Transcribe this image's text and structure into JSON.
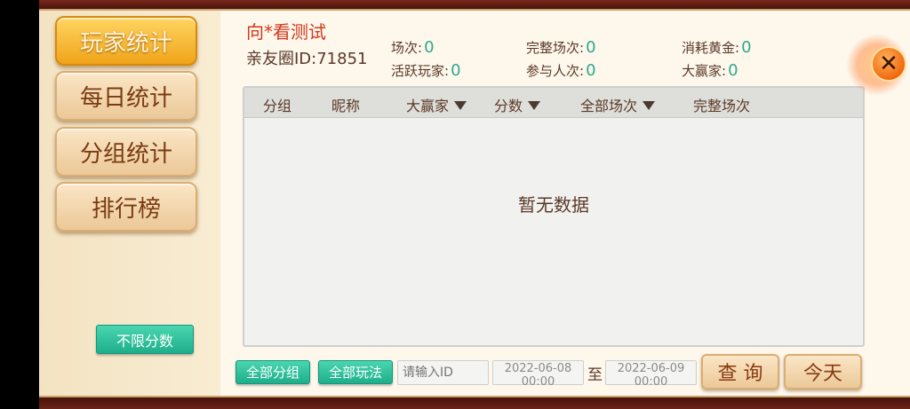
{
  "sidebar": {
    "tabs": [
      {
        "label": "玩家统计",
        "active": true
      },
      {
        "label": "每日统计",
        "active": false
      },
      {
        "label": "分组统计",
        "active": false
      },
      {
        "label": "排行榜",
        "active": false
      }
    ],
    "score_filter_label": "不限分数"
  },
  "header": {
    "title": "向*看测试",
    "circle_id": "亲友圈ID:71851",
    "stats": [
      {
        "label": "场次:",
        "value": "0"
      },
      {
        "label": "完整场次:",
        "value": "0"
      },
      {
        "label": "消耗黄金:",
        "value": "0"
      },
      {
        "label": "活跃玩家:",
        "value": "0"
      },
      {
        "label": "参与人次:",
        "value": "0"
      },
      {
        "label": "大赢家:",
        "value": "0"
      }
    ]
  },
  "table": {
    "columns": [
      {
        "label": "分组",
        "sortable": false
      },
      {
        "label": "昵称",
        "sortable": false
      },
      {
        "label": "大赢家",
        "sortable": true
      },
      {
        "label": "分数",
        "sortable": true
      },
      {
        "label": "全部场次",
        "sortable": true
      },
      {
        "label": "完整场次",
        "sortable": false
      }
    ],
    "empty_text": "暂无数据"
  },
  "filters": {
    "group_label": "全部分组",
    "play_label": "全部玩法",
    "id_placeholder": "请输入ID",
    "start_date": "2022-06-08",
    "start_time": "00:00",
    "to_label": "至",
    "end_date": "2022-06-09",
    "end_time": "00:00",
    "query_label": "查 询",
    "today_label": "今天"
  },
  "colors": {
    "active_tab": "#f0a419",
    "title": "#d13a1c",
    "stat_value": "#2fa88e",
    "green_button": "#1fae8b"
  },
  "icons": {
    "close": "close-icon",
    "sort": "sort-desc-triangle-icon"
  }
}
